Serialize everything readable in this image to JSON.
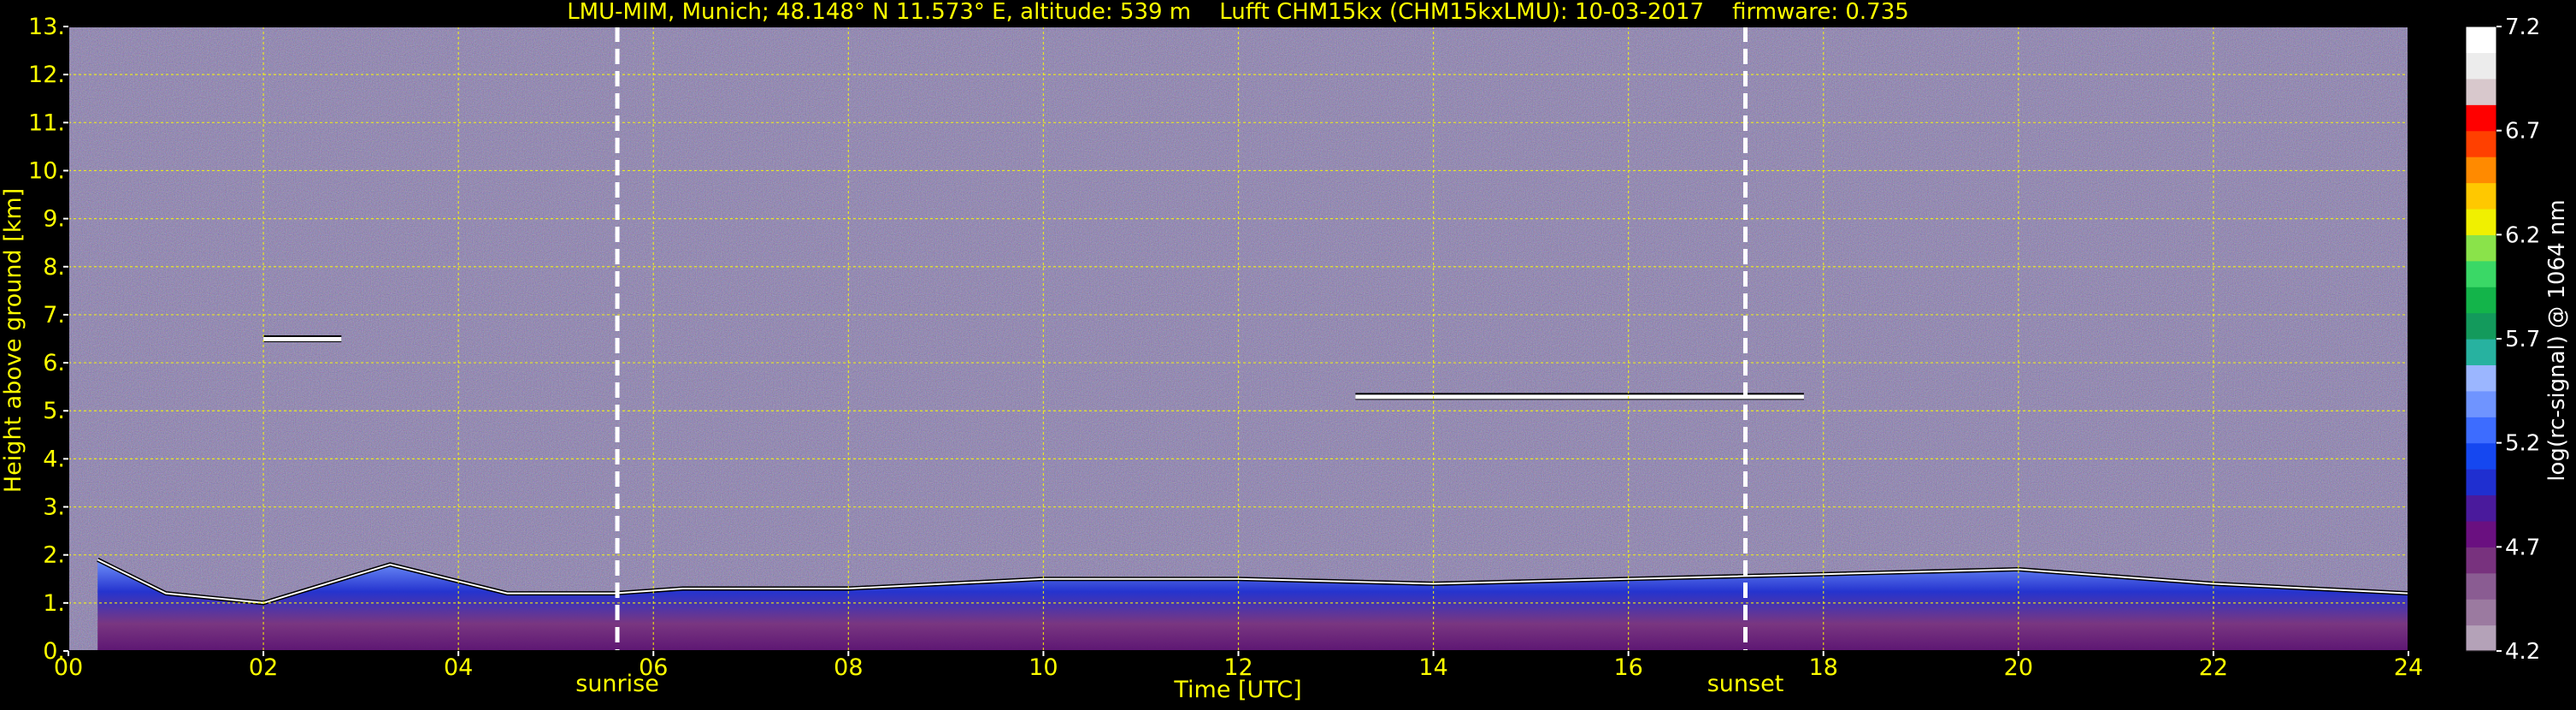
{
  "chart_data": {
    "type": "heatmap",
    "title": "LMU-MIM, Munich; 48.148° N 11.573° E, altitude: 539 m    Lufft CHM15kx (CHM15kxLMU): 10-03-2017    firmware: 0.735",
    "xlabel": "Time [UTC]",
    "ylabel": "Height above ground [km]",
    "x_ticks": [
      "00",
      "02",
      "04",
      "06",
      "08",
      "10",
      "12",
      "14",
      "16",
      "18",
      "20",
      "22",
      "24"
    ],
    "y_ticks": [
      "0.",
      "1.",
      "2.",
      "3.",
      "4.",
      "5.",
      "6.",
      "7.",
      "8.",
      "9.",
      "10.",
      "11.",
      "12.",
      "13."
    ],
    "xlim": [
      0,
      24
    ],
    "ylim": [
      0,
      13
    ],
    "grid": true,
    "colorbar": {
      "label": "log(rc-signal) @ 1064 nm",
      "range": [
        4.2,
        7.2
      ],
      "ticks": [
        "4.2",
        "4.7",
        "5.2",
        "5.7",
        "6.2",
        "6.7",
        "7.2"
      ],
      "colors": [
        "#b4a2b8",
        "#9b7aa0",
        "#8a5c92",
        "#78327e",
        "#6a1080",
        "#4a1a9c",
        "#1f2fd0",
        "#1547f0",
        "#3d6cff",
        "#6f94ff",
        "#9bb6ff",
        "#27b2a0",
        "#139a5c",
        "#13b44a",
        "#3ad866",
        "#8ae34a",
        "#f0f000",
        "#ffc800",
        "#ff8a00",
        "#ff4000",
        "#ff0000",
        "#d8c8cc",
        "#ececec",
        "#ffffff"
      ]
    },
    "markers": [
      {
        "label": "sunrise",
        "time": 5.63
      },
      {
        "label": "sunset",
        "time": 17.2
      }
    ],
    "cloud_layers": [
      {
        "t_start": 2.0,
        "t_end": 2.8,
        "height": 6.5
      },
      {
        "t_start": 13.2,
        "t_end": 17.8,
        "height": 5.3
      }
    ],
    "boundary_layer_top": [
      {
        "t": 0.3,
        "h": 1.9
      },
      {
        "t": 1.0,
        "h": 1.2
      },
      {
        "t": 2.0,
        "h": 1.0
      },
      {
        "t": 3.3,
        "h": 1.8
      },
      {
        "t": 4.5,
        "h": 1.2
      },
      {
        "t": 5.6,
        "h": 1.2
      },
      {
        "t": 6.3,
        "h": 1.3
      },
      {
        "t": 8.0,
        "h": 1.3
      },
      {
        "t": 10.0,
        "h": 1.5
      },
      {
        "t": 12.0,
        "h": 1.5
      },
      {
        "t": 14.0,
        "h": 1.4
      },
      {
        "t": 16.0,
        "h": 1.5
      },
      {
        "t": 18.0,
        "h": 1.6
      },
      {
        "t": 20.0,
        "h": 1.7
      },
      {
        "t": 22.0,
        "h": 1.4
      },
      {
        "t": 24.0,
        "h": 1.2
      }
    ]
  }
}
